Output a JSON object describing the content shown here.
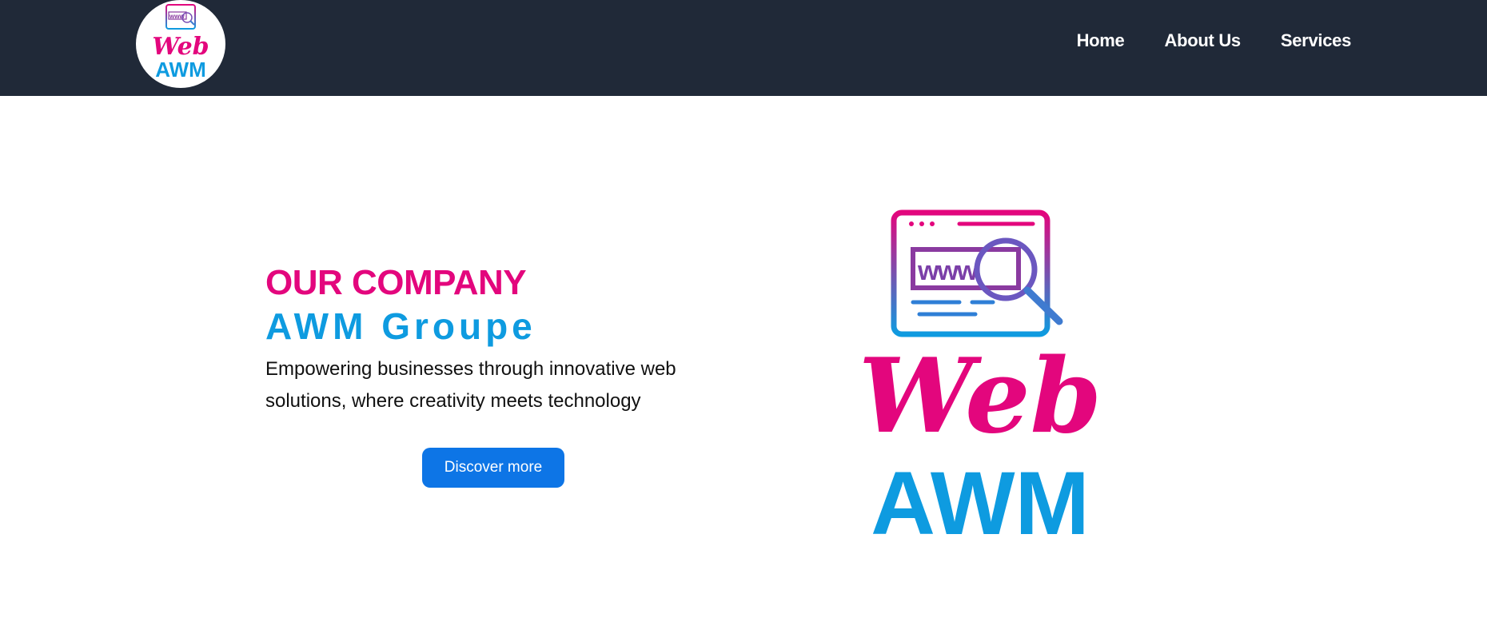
{
  "header": {
    "logo": {
      "word_top": "Web",
      "word_bottom": "AWM",
      "www": "www"
    },
    "nav": [
      {
        "label": "Home"
      },
      {
        "label": "About Us"
      },
      {
        "label": "Services"
      }
    ]
  },
  "hero": {
    "eyebrow": "OUR COMPANY",
    "company": "AWM Groupe",
    "tagline": " Empowering businesses through innovative web solutions, where creativity meets technology",
    "cta_label": "Discover more",
    "logo": {
      "word_top": "Web",
      "word_bottom": "AWM",
      "www": "www"
    }
  },
  "colors": {
    "nav_bg": "#202938",
    "accent_pink": "#e3067d",
    "accent_blue": "#0e9be0",
    "button_bg": "#0d75e6"
  }
}
